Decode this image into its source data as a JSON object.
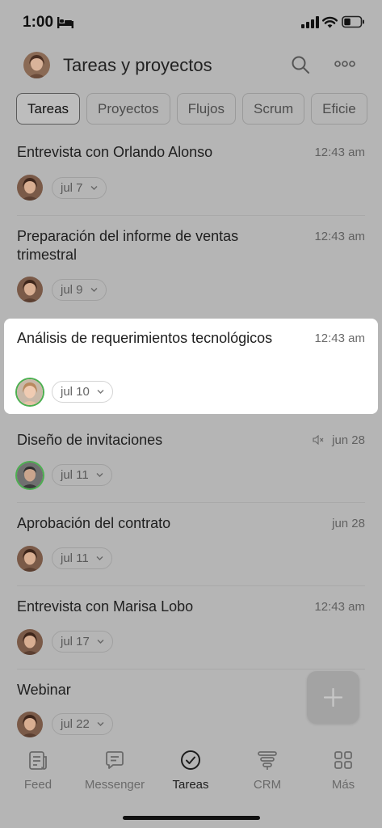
{
  "status_bar": {
    "time": "1:00"
  },
  "header": {
    "title": "Tareas y proyectos"
  },
  "tabs": [
    {
      "label": "Tareas",
      "active": true
    },
    {
      "label": "Proyectos"
    },
    {
      "label": "Flujos"
    },
    {
      "label": "Scrum"
    },
    {
      "label": "Eficie"
    }
  ],
  "tasks": [
    {
      "title": "Entrevista con Orlando Alonso",
      "time": "12:43 am",
      "deadline": "jul 7"
    },
    {
      "title": "Preparación del informe de ventas trimestral",
      "time": "12:43 am",
      "deadline": "jul 9"
    },
    {
      "title": "Análisis de requerimientos tecnológicos",
      "time": "12:43 am",
      "deadline": "jul 10",
      "highlighted": true
    },
    {
      "title": "Diseño de invitaciones",
      "time": "jun 28",
      "muted": true,
      "deadline": "jul 11"
    },
    {
      "title": "Aprobación del contrato",
      "time": "jun 28",
      "deadline": "jul 11"
    },
    {
      "title": "Entrevista con Marisa Lobo",
      "time": "12:43 am",
      "deadline": "jul 17"
    },
    {
      "title": "Webinar",
      "time": "",
      "deadline": "jul 22"
    }
  ],
  "nav": [
    {
      "label": "Feed",
      "icon": "feed-icon"
    },
    {
      "label": "Messenger",
      "icon": "messenger-icon"
    },
    {
      "label": "Tareas",
      "icon": "tasks-icon",
      "active": true
    },
    {
      "label": "CRM",
      "icon": "crm-icon"
    },
    {
      "label": "Más",
      "icon": "more-grid-icon"
    }
  ],
  "colors": {
    "overlay": "#b5b5b5",
    "highlight": "#ffffff",
    "accent_ring": "#4caf50"
  }
}
